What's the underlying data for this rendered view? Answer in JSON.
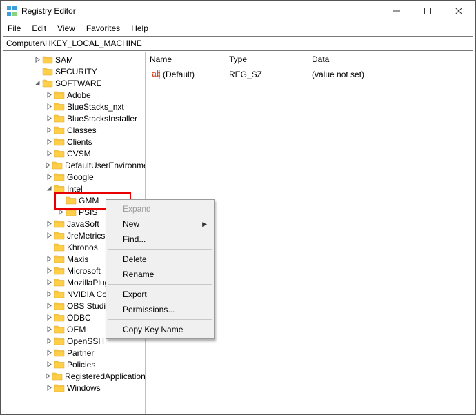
{
  "window": {
    "title": "Registry Editor"
  },
  "menubar": [
    "File",
    "Edit",
    "View",
    "Favorites",
    "Help"
  ],
  "addressbar": {
    "path": "Computer\\HKEY_LOCAL_MACHINE"
  },
  "tree": [
    {
      "indent": 2,
      "expander": "line",
      "label": "SAM"
    },
    {
      "indent": 2,
      "expander": "none",
      "label": "SECURITY"
    },
    {
      "indent": 2,
      "expander": "open",
      "label": "SOFTWARE"
    },
    {
      "indent": 3,
      "expander": "closed",
      "label": "Adobe"
    },
    {
      "indent": 3,
      "expander": "closed",
      "label": "BlueStacks_nxt"
    },
    {
      "indent": 3,
      "expander": "closed",
      "label": "BlueStacksInstaller"
    },
    {
      "indent": 3,
      "expander": "closed",
      "label": "Classes"
    },
    {
      "indent": 3,
      "expander": "closed",
      "label": "Clients"
    },
    {
      "indent": 3,
      "expander": "closed",
      "label": "CVSM"
    },
    {
      "indent": 3,
      "expander": "closed",
      "label": "DefaultUserEnvironment"
    },
    {
      "indent": 3,
      "expander": "closed",
      "label": "Google"
    },
    {
      "indent": 3,
      "expander": "open",
      "label": "Intel"
    },
    {
      "indent": 4,
      "expander": "none",
      "label": "GMM",
      "highlight": true
    },
    {
      "indent": 4,
      "expander": "closed",
      "label": "PSIS"
    },
    {
      "indent": 3,
      "expander": "closed",
      "label": "JavaSoft"
    },
    {
      "indent": 3,
      "expander": "closed",
      "label": "JreMetrics"
    },
    {
      "indent": 3,
      "expander": "none",
      "label": "Khronos"
    },
    {
      "indent": 3,
      "expander": "closed",
      "label": "Maxis"
    },
    {
      "indent": 3,
      "expander": "closed",
      "label": "Microsoft"
    },
    {
      "indent": 3,
      "expander": "closed",
      "label": "MozillaPlugins"
    },
    {
      "indent": 3,
      "expander": "closed",
      "label": "NVIDIA Corporation"
    },
    {
      "indent": 3,
      "expander": "closed",
      "label": "OBS Studio"
    },
    {
      "indent": 3,
      "expander": "closed",
      "label": "ODBC"
    },
    {
      "indent": 3,
      "expander": "closed",
      "label": "OEM"
    },
    {
      "indent": 3,
      "expander": "closed",
      "label": "OpenSSH"
    },
    {
      "indent": 3,
      "expander": "closed",
      "label": "Partner"
    },
    {
      "indent": 3,
      "expander": "closed",
      "label": "Policies"
    },
    {
      "indent": 3,
      "expander": "closed",
      "label": "RegisteredApplications"
    },
    {
      "indent": 3,
      "expander": "closed",
      "label": "Windows"
    }
  ],
  "list": {
    "columns": {
      "name": "Name",
      "type": "Type",
      "data": "Data"
    },
    "rows": [
      {
        "name": "(Default)",
        "type": "REG_SZ",
        "data": "(value not set)"
      }
    ]
  },
  "context_menu": [
    {
      "kind": "item",
      "label": "Expand",
      "disabled": true
    },
    {
      "kind": "item",
      "label": "New",
      "submenu": true
    },
    {
      "kind": "item",
      "label": "Find..."
    },
    {
      "kind": "sep"
    },
    {
      "kind": "item",
      "label": "Delete"
    },
    {
      "kind": "item",
      "label": "Rename"
    },
    {
      "kind": "sep"
    },
    {
      "kind": "item",
      "label": "Export"
    },
    {
      "kind": "item",
      "label": "Permissions..."
    },
    {
      "kind": "sep"
    },
    {
      "kind": "item",
      "label": "Copy Key Name"
    }
  ]
}
